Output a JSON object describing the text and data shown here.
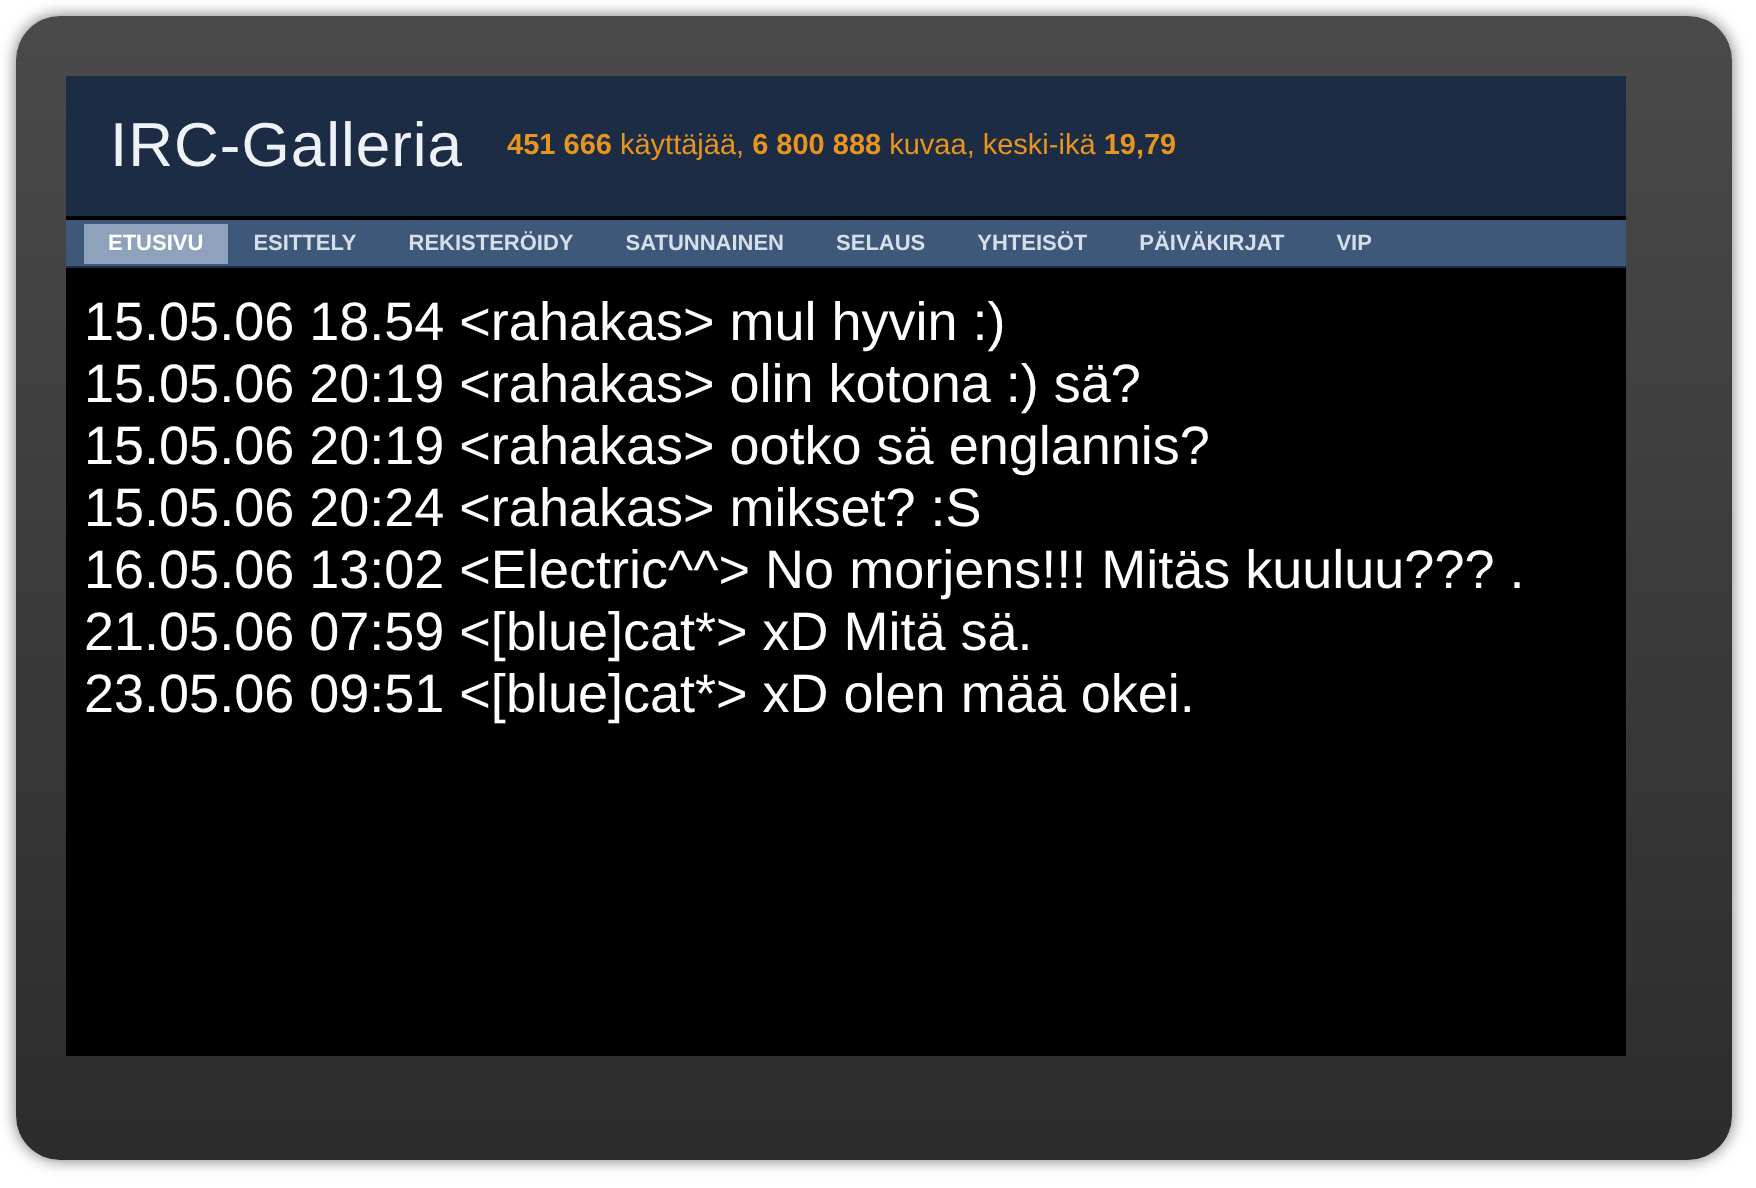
{
  "header": {
    "logo": "IRC-Galleria",
    "stats": "**451 666** käyttäjää, **6 800 888** kuvaa, keski-ikä **19,79**"
  },
  "nav": [
    {
      "label": "ETUSIVU",
      "selected": true
    },
    {
      "label": "ESITTELY",
      "selected": false
    },
    {
      "label": "REKISTERÖIDY",
      "selected": false
    },
    {
      "label": "SATUNNAINEN",
      "selected": false
    },
    {
      "label": "SELAUS",
      "selected": false
    },
    {
      "label": "YHTEISÖT",
      "selected": false
    },
    {
      "label": "PÄIVÄKIRJAT",
      "selected": false
    },
    {
      "label": "VIP",
      "selected": false
    }
  ],
  "messages": [
    "15.05.06 18.54 <rahakas> mul hyvin :)",
    "15.05.06 20:19 <rahakas> olin kotona :) sä?",
    "15.05.06 20:19 <rahakas> ootko sä englannis?",
    "15.05.06 20:24 <rahakas> mikset? :S",
    "16.05.06 13:02 <Electric^^> No morjens!!! Mitäs kuuluu??? .",
    "21.05.06 07:59 <[blue]cat*> xD Mitä sä.",
    "23.05.06 09:51 <[blue]cat*> xD olen mää okei."
  ]
}
